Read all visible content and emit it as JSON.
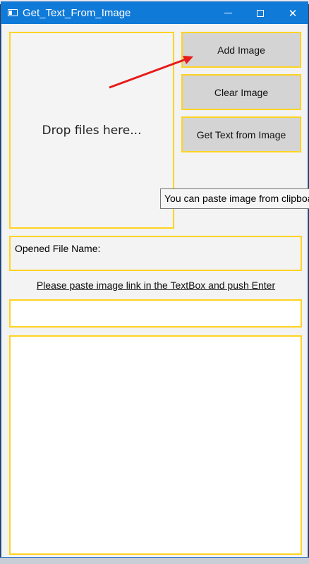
{
  "window": {
    "title": "Get_Text_From_Image",
    "minimize_label": "—",
    "maximize_label": "☐",
    "close_label": "✕"
  },
  "dropzone": {
    "label": "Drop files here..."
  },
  "buttons": {
    "add_image": "Add Image",
    "clear_image": "Clear Image",
    "get_text": "Get Text from Image"
  },
  "tooltip": {
    "text": "You can paste image from clipboard"
  },
  "file_info": {
    "label": "Opened File Name:"
  },
  "hint": {
    "text": "Please paste image link in the TextBox and push Enter"
  },
  "url_input": {
    "value": "",
    "placeholder": ""
  },
  "output": {
    "value": ""
  },
  "colors": {
    "titlebar": "#0f7ad8",
    "border_accent": "#ffd321",
    "arrow": "#e81a1a",
    "button_bg": "#d4d4d4"
  },
  "annotation": {
    "type": "red-arrow"
  }
}
